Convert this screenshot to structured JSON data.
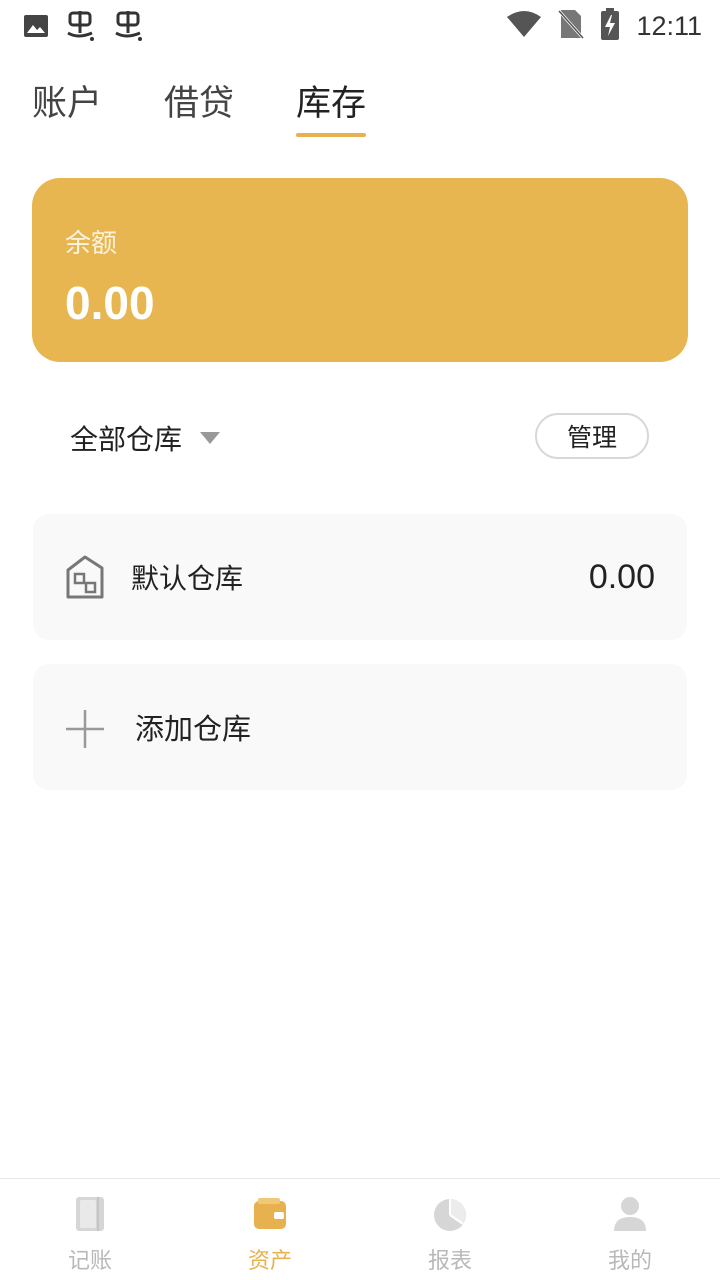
{
  "status_bar": {
    "time": "12:11",
    "left_icons": [
      "image-icon",
      "app-icon",
      "app-icon"
    ],
    "right_icons": [
      "wifi-icon",
      "no-sim-icon",
      "battery-charging-icon"
    ]
  },
  "tabs": [
    {
      "label": "账户",
      "active": false
    },
    {
      "label": "借贷",
      "active": false
    },
    {
      "label": "库存",
      "active": true
    }
  ],
  "balance_card": {
    "label": "余额",
    "value": "0.00",
    "color": "#e8b651"
  },
  "filter": {
    "label": "全部仓库",
    "manage_label": "管理"
  },
  "warehouses": [
    {
      "name": "默认仓库",
      "value": "0.00",
      "icon": "warehouse-icon"
    }
  ],
  "add_warehouse": {
    "label": "添加仓库",
    "icon": "plus-icon"
  },
  "bottom_nav": [
    {
      "label": "记账",
      "icon": "book-icon",
      "active": false
    },
    {
      "label": "资产",
      "icon": "wallet-icon",
      "active": true
    },
    {
      "label": "报表",
      "icon": "pie-chart-icon",
      "active": false
    },
    {
      "label": "我的",
      "icon": "user-icon",
      "active": false
    }
  ],
  "colors": {
    "accent": "#e8b14f",
    "card_background": "#f9f9f9",
    "inactive_nav": "#b9b9b9"
  }
}
